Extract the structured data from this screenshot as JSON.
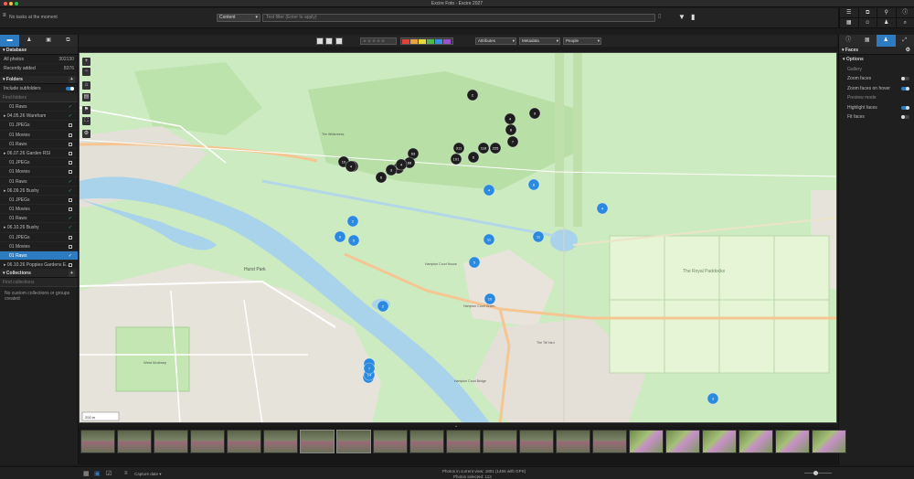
{
  "window": {
    "title": "Excire Foto - Excire 2027"
  },
  "toolbar": {
    "tasks": "No tasks at the moment",
    "search_scope": "Content",
    "search_placeholder": "Text filter (Enter to apply)"
  },
  "left_panel": {
    "database": {
      "label": "Database",
      "rows": [
        {
          "label": "All photos",
          "value": "302130"
        },
        {
          "label": "Recently added",
          "value": "8376"
        }
      ]
    },
    "folders": {
      "label": "Folders",
      "include_subfolders": "Include subfolders",
      "find_placeholder": "Find folders",
      "items": [
        {
          "label": "01 Raws",
          "indent": 1,
          "mark": "check"
        },
        {
          "label": "04.05.26 Wareham",
          "indent": 0,
          "mark": "check"
        },
        {
          "label": "01 JPEGs",
          "indent": 1,
          "mark": "box"
        },
        {
          "label": "01 Movies",
          "indent": 1,
          "mark": "box"
        },
        {
          "label": "01 Raws",
          "indent": 1,
          "mark": "box"
        },
        {
          "label": "06.07.26 Garden RSI",
          "indent": 0,
          "mark": "box"
        },
        {
          "label": "01 JPEGs",
          "indent": 1,
          "mark": "box"
        },
        {
          "label": "01 Movies",
          "indent": 1,
          "mark": "box"
        },
        {
          "label": "01 Raws",
          "indent": 1,
          "mark": "check"
        },
        {
          "label": "06.09.26 Bushy",
          "indent": 0,
          "mark": "check"
        },
        {
          "label": "01 JPEGs",
          "indent": 1,
          "mark": "box"
        },
        {
          "label": "01 Movies",
          "indent": 1,
          "mark": "box"
        },
        {
          "label": "01 Raws",
          "indent": 1,
          "mark": "check"
        },
        {
          "label": "06.10.26 Bushy",
          "indent": 0,
          "mark": "check"
        },
        {
          "label": "01 JPEGs",
          "indent": 1,
          "mark": "box"
        },
        {
          "label": "01 Movies",
          "indent": 1,
          "mark": "box"
        },
        {
          "label": "01 Raws",
          "indent": 1,
          "mark": "check",
          "selected": true
        },
        {
          "label": "06.10.26 Poppies Gardens E...",
          "indent": 0,
          "mark": "box"
        }
      ]
    },
    "collections": {
      "label": "Collections",
      "find_placeholder": "Find collections",
      "empty": "No custom collections or groups created"
    }
  },
  "map_bar": {
    "attributes": "Attributes",
    "metadata": "Metadata",
    "people": "People",
    "stars": "☆☆☆☆☆",
    "colors": [
      "#e0413a",
      "#e8a33a",
      "#e6d93a",
      "#54b848",
      "#3b8fe0",
      "#9b4fd1"
    ]
  },
  "map": {
    "labels": [
      {
        "text": "Hurst Park"
      },
      {
        "text": "Hampton Court House"
      },
      {
        "text": "Hampton Court Green"
      },
      {
        "text": "The Royal Paddocks"
      },
      {
        "text": "West Molesey"
      },
      {
        "text": "Hampton Court Bridge"
      },
      {
        "text": "The Tilt Yard"
      },
      {
        "text": "The Wilderness"
      }
    ],
    "black_clusters": [
      "2",
      "9",
      "4",
      "8",
      "101",
      "118",
      "225",
      "7",
      "6",
      "311",
      "63",
      "88",
      "81",
      "3",
      "4",
      "6",
      "105",
      "10",
      "4"
    ],
    "blue_clusters": [
      "4",
      "8",
      "4",
      "2",
      "6",
      "5",
      "11",
      "11",
      "5",
      "10",
      "2",
      "3",
      "8",
      "14",
      "3",
      "7"
    ],
    "scale": "200 m"
  },
  "right_panel": {
    "section": "Faces",
    "options": "Options",
    "gallery": "Gallery",
    "zoom_faces": "Zoom faces",
    "zoom_on_hover": "Zoom faces on hover",
    "preview_mode": "Preview mode",
    "highlight_faces": "Highlight faces",
    "fit_faces": "Fit faces"
  },
  "status": {
    "capture_date": "Capture date",
    "photos_in_view": "Photos in current view:",
    "photos_in_view_value": "1801 (1456 with GPS)",
    "photos_selected": "Photos selected:",
    "photos_selected_value": "113"
  }
}
